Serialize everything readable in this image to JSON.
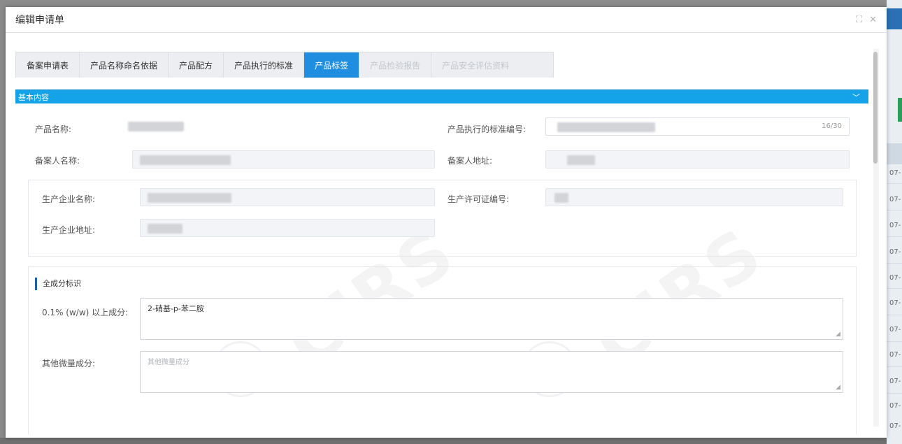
{
  "modal": {
    "title": "编辑申请单",
    "maximize_icon": "maximize-icon",
    "close_icon": "close-icon"
  },
  "tabs": [
    {
      "label": "备案申请表",
      "state": "normal"
    },
    {
      "label": "产品名称命名依据",
      "state": "normal"
    },
    {
      "label": "产品配方",
      "state": "normal"
    },
    {
      "label": "产品执行的标准",
      "state": "normal"
    },
    {
      "label": "产品标签",
      "state": "active"
    },
    {
      "label": "产品检验报告",
      "state": "disabled"
    },
    {
      "label": "产品安全评估资料",
      "state": "disabled"
    }
  ],
  "section": {
    "title": "基本内容",
    "toggle_icon": "chevron-down-icon",
    "color": "#14a3e8"
  },
  "fields": {
    "product_name_label": "产品名称:",
    "standard_no_label": "产品执行的标准编号:",
    "standard_no_count": "16/30",
    "filer_name_label": "备案人名称:",
    "filer_address_label": "备案人地址:",
    "manufacturer_name_label": "生产企业名称:",
    "license_no_label": "生产许可证编号:",
    "manufacturer_address_label": "生产企业地址:"
  },
  "ingredients": {
    "title": "全成分标识",
    "above_label": "0.1% (w/w) 以上成分:",
    "above_value": "2-硝基-p-苯二胺",
    "trace_label": "其他微量成分:",
    "trace_placeholder": "其他微量成分"
  },
  "background": {
    "row_text": "07-"
  },
  "colors": {
    "active_tab": "#1f8de0",
    "section_bar": "#14a3e8",
    "subtitle_accent": "#1f5fb0"
  }
}
